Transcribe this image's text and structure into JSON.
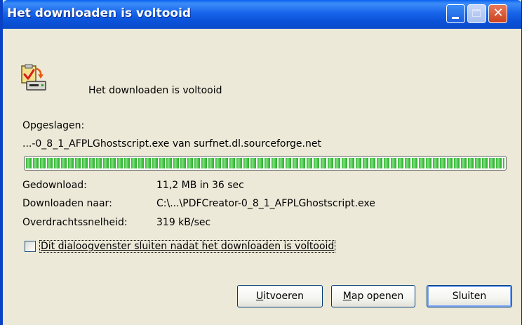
{
  "window": {
    "title": "Het downloaden is voltooid",
    "close_glyph": "✕"
  },
  "header": {
    "icon": "download-complete-icon",
    "message": "Het downloaden is voltooid"
  },
  "saved": {
    "label": "Opgeslagen:",
    "source": "...-0_8_1_AFPLGhostscript.exe van surfnet.dl.sourceforge.net"
  },
  "progress": {
    "percent": 100
  },
  "details": {
    "downloaded_label": "Gedownload:",
    "downloaded_value": "11,2 MB in 36 sec",
    "destination_label": "Downloaden naar:",
    "destination_value": "C:\\...\\PDFCreator-0_8_1_AFPLGhostscript.exe",
    "rate_label": "Overdrachtssnelheid:",
    "rate_value": "319 kB/sec"
  },
  "checkbox": {
    "label": "Dit dialoogvenster sluiten nadat het downloaden is voltooid",
    "checked": false
  },
  "buttons": {
    "run": {
      "accel": "U",
      "rest": "itvoeren"
    },
    "open_folder": {
      "accel": "M",
      "rest": "ap openen"
    },
    "close": "Sluiten"
  },
  "colors": {
    "titlebar": "#0a52d8",
    "progress_green": "#32b432",
    "face": "#ece9d8"
  }
}
